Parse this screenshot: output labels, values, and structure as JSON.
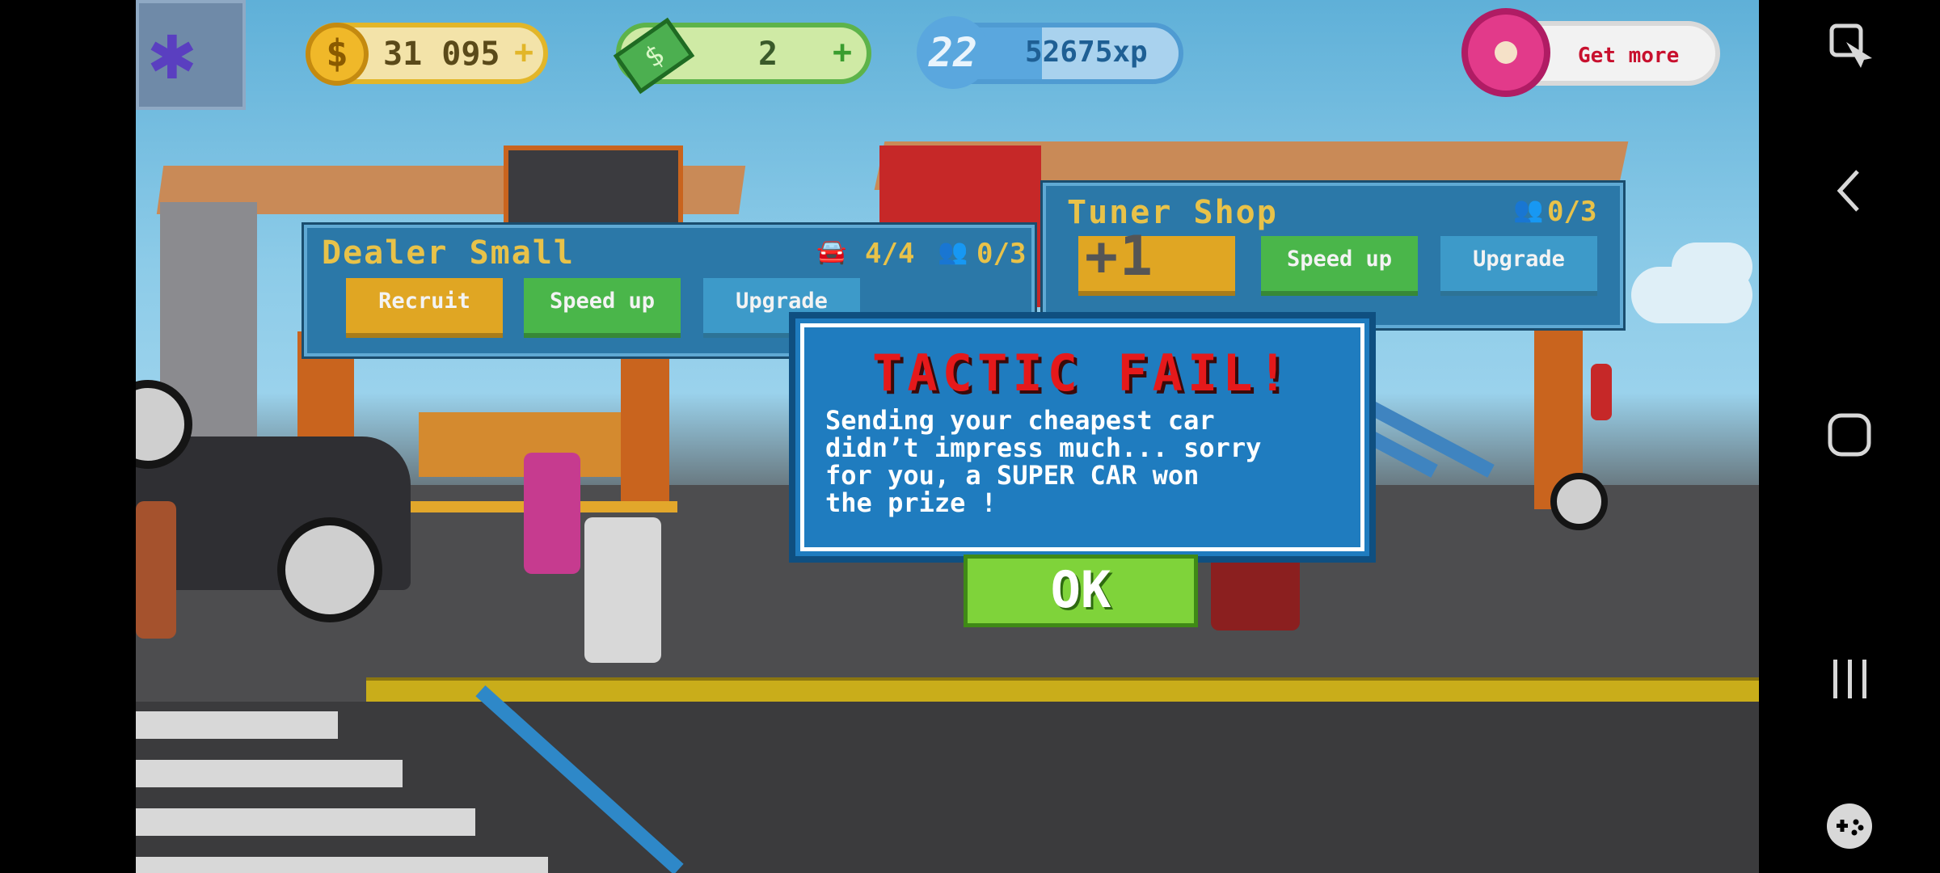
{
  "hud": {
    "coins": "31 095",
    "coins_plus": "+",
    "coin_icon": "$",
    "cash": "2",
    "cash_plus": "+",
    "cash_icon": "$",
    "level": "22",
    "xp": "52675xp",
    "xp_progress": 0.45,
    "get_more": "Get more"
  },
  "dealer_panel": {
    "title": "Dealer Small",
    "cars_count": "4/4",
    "staff_count": "0/3",
    "recruit": "Recruit",
    "speed_up": "Speed up",
    "upgrade": "Upgrade"
  },
  "tuner_panel": {
    "title": "Tuner Shop",
    "staff_count": "0/3",
    "floating_bonus": "+1",
    "speed_up": "Speed up",
    "upgrade": "Upgrade"
  },
  "dialog": {
    "title": "TACTIC FAIL!",
    "message": "Sending your cheapest car\ndidn’t impress much... sorry\nfor you, a SUPER CAR won\nthe prize !",
    "ok": "OK"
  },
  "icons": {
    "screenshot": "screenshot-tool-icon",
    "back": "back-icon",
    "home": "home-icon",
    "recents": "recents-icon",
    "game_launcher": "game-controller-icon"
  },
  "colors": {
    "dialog_title": "#e5191b",
    "panel_title": "#e8c249",
    "ok_button": "#7fd33a"
  }
}
